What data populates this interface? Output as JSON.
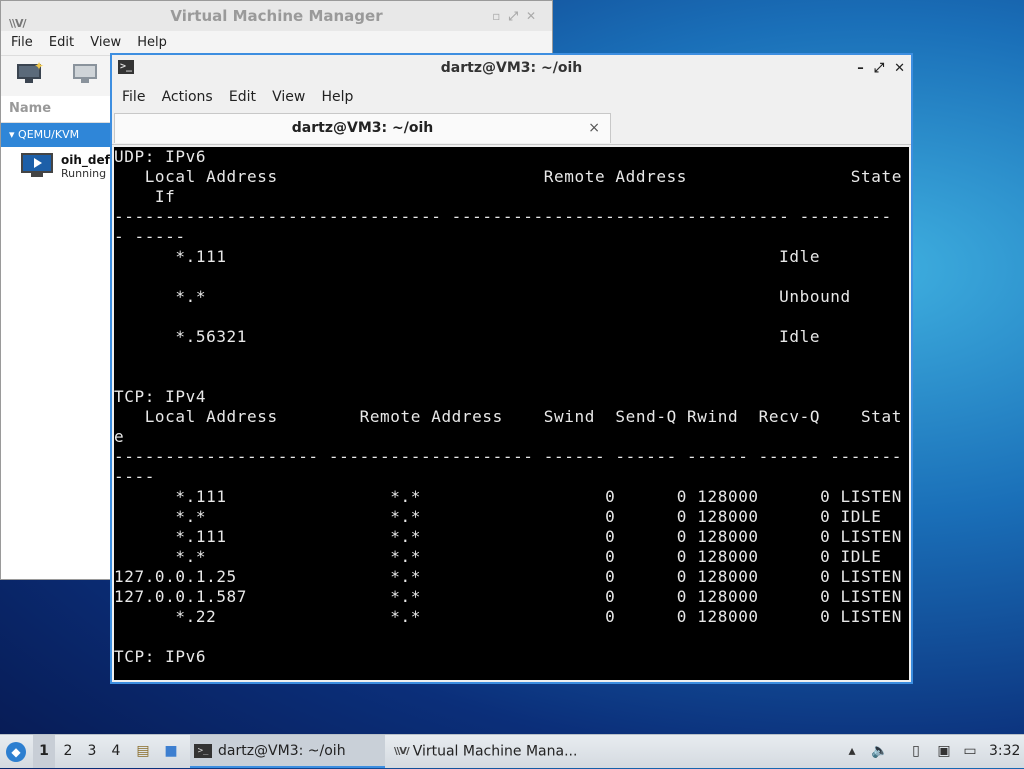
{
  "vmm": {
    "title": "Virtual Machine Manager",
    "menu": [
      "File",
      "Edit",
      "View",
      "Help"
    ],
    "column_name": "Name",
    "group": "QEMU/KVM",
    "vm": {
      "name": "oih_defa",
      "status": "Running"
    }
  },
  "terminal": {
    "title": "dartz@VM3: ~/oih",
    "menu": [
      "File",
      "Actions",
      "Edit",
      "View",
      "Help"
    ],
    "tab_title": "dartz@VM3: ~/oih",
    "tab_close": "×",
    "lines": [
      "UDP: IPv6",
      "   Local Address                          Remote Address                State",
      "    If",
      "-------------------------------- --------------------------------- ---------",
      "- -----",
      "      *.111                                                      Idle",
      "",
      "      *.*                                                        Unbound",
      "",
      "      *.56321                                                    Idle",
      "",
      "",
      "TCP: IPv4",
      "   Local Address        Remote Address    Swind  Send-Q Rwind  Recv-Q    Stat",
      "e",
      "-------------------- -------------------- ------ ------ ------ ------ -------",
      "----",
      "      *.111                *.*                  0      0 128000      0 LISTEN",
      "      *.*                  *.*                  0      0 128000      0 IDLE",
      "      *.111                *.*                  0      0 128000      0 LISTEN",
      "      *.*                  *.*                  0      0 128000      0 IDLE",
      "127.0.0.1.25               *.*                  0      0 128000      0 LISTEN",
      "127.0.0.1.587              *.*                  0      0 128000      0 LISTEN",
      "      *.22                 *.*                  0      0 128000      0 LISTEN",
      "",
      "TCP: IPv6"
    ]
  },
  "taskbar": {
    "workspaces": [
      "1",
      "2",
      "3",
      "4"
    ],
    "active_workspace": "1",
    "tasks": [
      {
        "label": "dartz@VM3: ~/oih",
        "active": true
      },
      {
        "label": "Virtual Machine Mana...",
        "active": false
      }
    ],
    "clock": "3:32"
  },
  "colors": {
    "accent": "#3d8ee0",
    "vmm_group_bg": "#2f86d8",
    "terminal_bg": "#000000",
    "terminal_fg": "#e8e8e8"
  }
}
